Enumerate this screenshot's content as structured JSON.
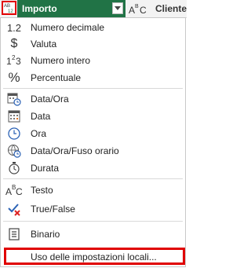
{
  "header": {
    "columns": [
      {
        "label": "Importo",
        "type_icon": "abc-123-type-icon",
        "active": true
      },
      {
        "label": "Cliente",
        "type_icon": "abc-type-icon",
        "active": false
      }
    ]
  },
  "menu": {
    "items": [
      {
        "icon_text": "1.2",
        "icon": "decimal-number-icon",
        "label": "Numero decimale"
      },
      {
        "icon_text": "$",
        "icon": "currency-icon",
        "label": "Valuta"
      },
      {
        "icon_text": "123",
        "icon": "whole-number-icon",
        "label": "Numero intero"
      },
      {
        "icon_text": "%",
        "icon": "percent-icon",
        "label": "Percentuale"
      },
      {
        "icon": "datetime-icon",
        "label": "Data/Ora"
      },
      {
        "icon": "date-icon",
        "label": "Data"
      },
      {
        "icon": "time-icon",
        "label": "Ora"
      },
      {
        "icon": "datetime-timezone-icon",
        "label": "Data/Ora/Fuso orario"
      },
      {
        "icon": "duration-icon",
        "label": "Durata"
      },
      {
        "icon_text": "ABC",
        "icon": "text-icon",
        "label": "Testo"
      },
      {
        "icon": "true-false-icon",
        "label": "True/False"
      },
      {
        "icon": "binary-icon",
        "label": "Binario"
      }
    ],
    "locale_label": "Uso delle impostazioni locali..."
  },
  "colors": {
    "accent": "#217346",
    "highlight": "#e00000",
    "icon_blue": "#2b62b5"
  }
}
